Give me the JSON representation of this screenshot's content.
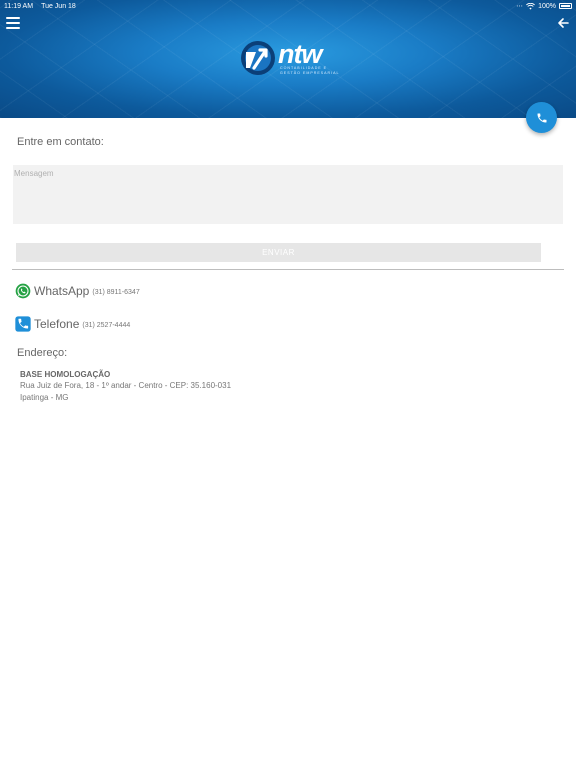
{
  "status_bar": {
    "time": "11:19 AM",
    "date": "Tue Jun 18",
    "battery": "100%"
  },
  "header": {
    "logo_text": "ntw",
    "logo_tagline_1": "CONTABILIDADE E",
    "logo_tagline_2": "GESTÃO EMPRESARIAL",
    "menu_icon": "hamburger-icon",
    "back_icon": "arrow-left-icon"
  },
  "fab": {
    "icon": "phone-icon",
    "color": "#1f8fd8"
  },
  "contact_form": {
    "title": "Entre em contato:",
    "message_placeholder": "Mensagem",
    "message_value": "",
    "send_label": "ENVIAR"
  },
  "contacts": [
    {
      "type": "WhatsApp",
      "number": "(31) 8911-6347",
      "icon": "whatsapp-icon",
      "color": "#25a244"
    },
    {
      "type": "Telefone",
      "number": "(31) 2527-4444",
      "icon": "phone-icon",
      "color": "#1f8fd8"
    }
  ],
  "address": {
    "title": "Endereço:",
    "name": "BASE HOMOLOGAÇÃO",
    "line1": "Rua Juiz de Fora, 18 - 1º andar - Centro - CEP: 35.160-031",
    "line2": "Ipatinga - MG"
  }
}
